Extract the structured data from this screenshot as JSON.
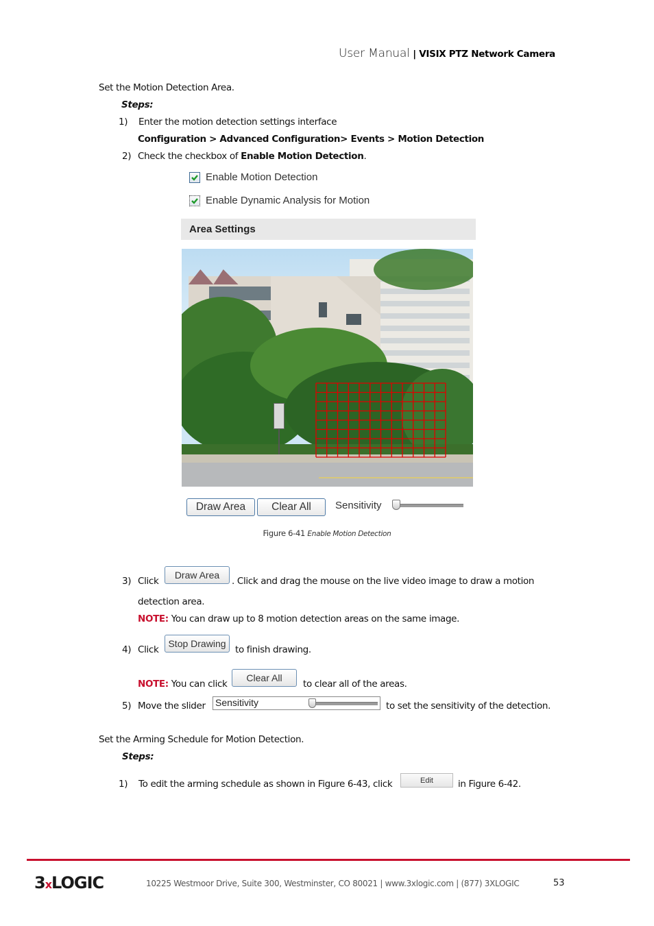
{
  "header": {
    "doc_type": "User Manual",
    "separator": "|",
    "product": "VISIX PTZ Network Camera"
  },
  "section1": {
    "title": "Set the Motion Detection Area.",
    "steps_label": "Steps:",
    "step1": {
      "num": "1)",
      "text": "Enter the motion detection settings interface",
      "path": "Configuration > Advanced Configuration> Events > Motion Detection"
    },
    "step2": {
      "num": "2)",
      "text_before": "Check the checkbox of ",
      "bold": "Enable Motion Detection",
      "text_after": "."
    }
  },
  "figure": {
    "checkboxes": [
      {
        "label": "Enable Motion Detection",
        "checked": true
      },
      {
        "label": "Enable Dynamic Analysis for Motion",
        "checked": true
      }
    ],
    "area_settings_title": "Area Settings",
    "grid": {
      "columns": 12,
      "rows": 8,
      "color": "#e00000"
    },
    "draw_area_button": "Draw Area",
    "clear_all_button": "Clear All",
    "sensitivity_label": "Sensitivity",
    "sensitivity_value": 0,
    "caption_num": "Figure 6-41",
    "caption_title": "Enable Motion Detection"
  },
  "step3": {
    "num": "3)",
    "click": "Click",
    "button": "Draw Area",
    "text": ". Click and drag the mouse on the live video image to draw a motion",
    "text2": "detection area.",
    "note_label": "NOTE:",
    "note_text": " You can draw up to 8 motion detection areas on the same image."
  },
  "step4": {
    "num": "4)",
    "click": "Click",
    "button": "Stop Drawing",
    "text": "to finish drawing.",
    "note_label": "NOTE:",
    "note_text": " You can click",
    "note_button": "Clear All",
    "note_after": "to clear all of the areas."
  },
  "step5": {
    "num": "5)",
    "text": "Move the slider",
    "slider_label": "Sensitivity",
    "slider_value": 0,
    "text_after": "to set the sensitivity of the detection."
  },
  "section2": {
    "title": "Set the Arming Schedule for Motion Detection.",
    "steps_label": "Steps:",
    "step1": {
      "num": "1)",
      "text": "To edit the arming schedule as shown in Figure 6-43, click",
      "button": "Edit",
      "text_after": "in Figure 6-42."
    }
  },
  "footer": {
    "logo_a": "3",
    "logo_x": "x",
    "logo_b": "LOGIC",
    "address": "10225 Westmoor Drive, Suite 300, Westminster, CO 80021 | www.3xlogic.com | (877) 3XLOGIC",
    "page_number": "53",
    "accent_color": "#c8102e"
  }
}
